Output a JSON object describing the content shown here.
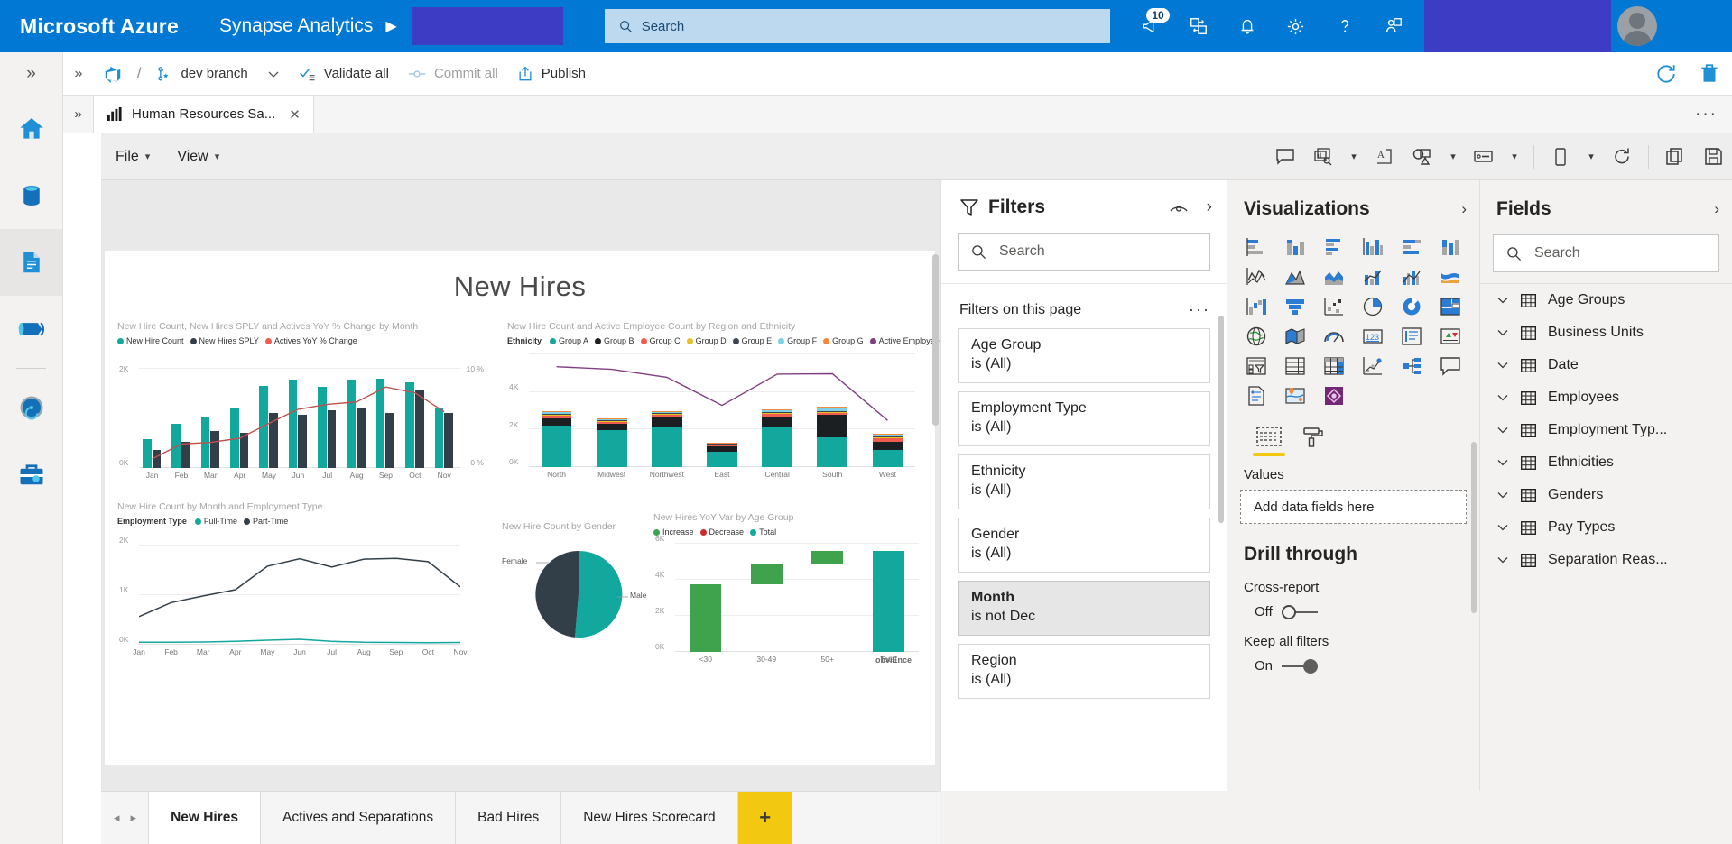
{
  "azure": {
    "brand": "Microsoft Azure",
    "service": "Synapse Analytics",
    "service_chevron": "▶",
    "search_placeholder": "Search",
    "notifications_badge": "10",
    "icons": [
      "megaphone-icon",
      "cloudshell-icon",
      "bell-icon",
      "gear-icon",
      "help-icon",
      "feedback-icon"
    ]
  },
  "synapse_toolbar": {
    "slash": "/",
    "branch": "dev branch",
    "branch_chevron": "⌄",
    "validate_all": "Validate all",
    "commit_all": "Commit all",
    "publish": "Publish"
  },
  "report_tab": {
    "label": "Human Resources Sa...",
    "close": "✕",
    "expand": "»",
    "overflow": "···"
  },
  "pbi_toolbar": {
    "file": "File",
    "view": "View",
    "chevron": "⌄",
    "icons": [
      "comment-icon",
      "bookmarks-icon",
      "chevron-down-icon",
      "text-box-icon",
      "shapes-icon",
      "chevron-down-icon",
      "buttons-icon",
      "chevron-down-icon",
      "mobile-layout-icon",
      "chevron-down-icon",
      "refresh-icon",
      "duplicate-page-icon",
      "save-icon"
    ]
  },
  "report": {
    "title": "New Hires"
  },
  "chart_data": [
    {
      "type": "bar",
      "id": "new-hire-count-by-month",
      "title": "New Hire Count, New Hires SPLY and Actives YoY % Change by Month",
      "legend": [
        {
          "label": "New Hire Count",
          "color": "#13a89e"
        },
        {
          "label": "New Hires SPLY",
          "color": "#333f48"
        },
        {
          "label": "Actives YoY % Change",
          "color": "#ee5d50"
        }
      ],
      "categories": [
        "Jan",
        "Feb",
        "Mar",
        "Apr",
        "May",
        "Jun",
        "Jul",
        "Aug",
        "Sep",
        "Oct",
        "Nov"
      ],
      "series": [
        {
          "name": "New Hire Count",
          "color": "#13a89e",
          "values": [
            700,
            1080,
            1250,
            1450,
            1990,
            2130,
            1970,
            2130,
            2170,
            2070,
            1440
          ]
        },
        {
          "name": "New Hires SPLY",
          "color": "#333f48",
          "values": [
            430,
            640,
            900,
            860,
            1330,
            1280,
            1390,
            1470,
            1330,
            1900,
            1340
          ]
        },
        {
          "name": "Actives YoY % Change",
          "color": "#c0504d",
          "values": [
            1.1,
            2.9,
            3.1,
            3.6,
            5.4,
            7.1,
            7.7,
            8.0,
            9.8,
            9.1,
            6.8
          ]
        }
      ],
      "ylabel": "",
      "ylim": [
        0,
        2400
      ],
      "yticks": [
        "0K",
        "2K"
      ],
      "y2ticks": [
        "0 %",
        "10 %"
      ],
      "y2lim": [
        0,
        12
      ],
      "grid": true,
      "legend_position": "top"
    },
    {
      "type": "bar",
      "id": "new-hire-by-region-ethnicity",
      "title": "New Hire Count and Active Employee Count by Region and Ethnicity",
      "legend_title": "Ethnicity",
      "legend": [
        {
          "label": "Group A",
          "color": "#13a89e"
        },
        {
          "label": "Group B",
          "color": "#1b1f22"
        },
        {
          "label": "Group C",
          "color": "#ee5d50"
        },
        {
          "label": "Group D",
          "color": "#e8c020"
        },
        {
          "label": "Group E",
          "color": "#3b4650"
        },
        {
          "label": "Group F",
          "color": "#7dd0e8"
        },
        {
          "label": "Group G",
          "color": "#f2893f"
        },
        {
          "label": "Active Employee Count",
          "color": "#80407f"
        }
      ],
      "categories": [
        "North",
        "Midwest",
        "Northwest",
        "East",
        "Central",
        "South",
        "West"
      ],
      "stacked": true,
      "series": [
        {
          "name": "Group A",
          "color": "#13a89e",
          "values": [
            2380,
            2100,
            2250,
            860,
            2300,
            1680,
            980
          ]
        },
        {
          "name": "Group B",
          "color": "#1b1f22",
          "values": [
            360,
            350,
            620,
            300,
            580,
            1270,
            460
          ]
        },
        {
          "name": "Group C",
          "color": "#ee5d50",
          "values": [
            160,
            130,
            90,
            90,
            150,
            100,
            190
          ]
        },
        {
          "name": "Group D",
          "color": "#e8c020",
          "values": [
            80,
            70,
            60,
            50,
            70,
            90,
            80
          ]
        },
        {
          "name": "Group E",
          "color": "#3b4650",
          "values": [
            40,
            30,
            30,
            30,
            40,
            40,
            30
          ]
        },
        {
          "name": "Group F",
          "color": "#7dd0e8",
          "values": [
            140,
            40,
            80,
            40,
            90,
            160,
            110
          ]
        },
        {
          "name": "Group G",
          "color": "#f2893f",
          "values": [
            40,
            20,
            30,
            20,
            30,
            80,
            40
          ]
        }
      ],
      "line_series": {
        "name": "Active Employee Count",
        "color": "#80407f",
        "values": [
          5700,
          5550,
          5100,
          3500,
          5280,
          5300,
          2650
        ]
      },
      "ylim": [
        0,
        6400
      ],
      "yticks": [
        "0K",
        "2K",
        "4K"
      ],
      "grid": true,
      "legend_position": "top"
    },
    {
      "type": "line",
      "id": "new-hire-by-month-employment-type",
      "title": "New Hire Count by Month and Employment Type",
      "legend_title": "Employment Type",
      "legend": [
        {
          "label": "Full-Time",
          "color": "#13a89e"
        },
        {
          "label": "Part-Time",
          "color": "#333f48"
        }
      ],
      "categories": [
        "Jan",
        "Feb",
        "Mar",
        "Apr",
        "May",
        "Jun",
        "Jul",
        "Aug",
        "Sep",
        "Oct",
        "Nov"
      ],
      "series": [
        {
          "name": "Part-Time",
          "color": "#333f48",
          "values": [
            680,
            1020,
            1180,
            1330,
            1900,
            2080,
            1880,
            2070,
            2090,
            2010,
            1400
          ]
        },
        {
          "name": "Full-Time",
          "color": "#13a89e",
          "values": [
            60,
            60,
            65,
            80,
            110,
            130,
            80,
            60,
            55,
            50,
            55
          ]
        }
      ],
      "ylim": [
        0,
        2400
      ],
      "yticks": [
        "0K",
        "1K",
        "2K"
      ],
      "grid": true,
      "legend_position": "top"
    },
    {
      "type": "pie",
      "id": "new-hire-count-by-gender",
      "title": "New Hire Count by Gender",
      "labels": [
        "Male",
        "Female"
      ],
      "values": [
        52,
        48
      ],
      "colors": [
        "#13a89e",
        "#333f48"
      ]
    },
    {
      "type": "bar",
      "id": "new-hires-yoy-var-by-age-group",
      "title": "New Hires YoY Var by Age Group",
      "legend": [
        {
          "label": "Increase",
          "color": "#3fa34d"
        },
        {
          "label": "Decrease",
          "color": "#d22a2a"
        },
        {
          "label": "Total",
          "color": "#13a89e"
        }
      ],
      "categories": [
        "<30",
        "30-49",
        "50+",
        "Total"
      ],
      "waterfall": [
        {
          "category": "<30",
          "start": 0,
          "end": 4000,
          "kind": "Increase"
        },
        {
          "category": "30-49",
          "start": 4000,
          "end": 5250,
          "kind": "Increase"
        },
        {
          "category": "50+",
          "start": 5250,
          "end": 5950,
          "kind": "Increase"
        },
        {
          "category": "Total",
          "start": 0,
          "end": 5950,
          "kind": "Total"
        }
      ],
      "ylim": [
        0,
        6400
      ],
      "yticks": [
        "0K",
        "2K",
        "4K",
        "6K"
      ],
      "grid": true,
      "legend_position": "top"
    }
  ],
  "watermark": "obviEnce",
  "filters": {
    "title": "Filters",
    "search_placeholder": "Search",
    "section_label": "Filters on this page",
    "overflow": "···",
    "expand_arrow": "›",
    "items": [
      {
        "name": "Age Group",
        "value": "is (All)",
        "active": false
      },
      {
        "name": "Employment Type",
        "value": "is (All)",
        "active": false
      },
      {
        "name": "Ethnicity",
        "value": "is (All)",
        "active": false
      },
      {
        "name": "Gender",
        "value": "is (All)",
        "active": false
      },
      {
        "name": "Month",
        "value": "is not Dec",
        "active": true
      },
      {
        "name": "Region",
        "value": "is (All)",
        "active": false
      }
    ]
  },
  "visualizations": {
    "title": "Visualizations",
    "expand_arrow": "›",
    "gallery": [
      "stacked-bar-chart-icon",
      "stacked-column-chart-icon",
      "clustered-bar-chart-icon",
      "clustered-column-chart-icon",
      "100-stacked-bar-chart-icon",
      "100-stacked-column-chart-icon",
      "line-chart-icon",
      "area-chart-icon",
      "stacked-area-chart-icon",
      "line-and-stacked-column-chart-icon",
      "line-and-clustered-column-chart-icon",
      "ribbon-chart-icon",
      "waterfall-chart-icon",
      "funnel-chart-icon",
      "scatter-chart-icon",
      "pie-chart-icon",
      "donut-chart-icon",
      "treemap-icon",
      "map-icon",
      "filled-map-icon",
      "gauge-icon",
      "card-icon",
      "multi-row-card-icon",
      "kpi-icon",
      "slicer-icon",
      "table-icon",
      "matrix-icon",
      "r-script-visual-icon",
      "decomposition-tree-icon",
      "q-and-a-icon",
      "paginated-report-icon",
      "arcgis-maps-icon",
      "power-apps-icon"
    ],
    "tabs": [
      "fields-well-icon",
      "format-paint-roller-icon"
    ],
    "values_label": "Values",
    "drop_placeholder": "Add data fields here",
    "drill_through_title": "Drill through",
    "cross_report_label": "Cross-report",
    "cross_report_state": "Off",
    "keep_all_filters_label": "Keep all filters",
    "keep_all_filters_state": "On"
  },
  "fields": {
    "title": "Fields",
    "expand_arrow": "›",
    "search_placeholder": "Search",
    "items": [
      {
        "label": "Age Groups"
      },
      {
        "label": "Business Units"
      },
      {
        "label": "Date"
      },
      {
        "label": "Employees"
      },
      {
        "label": "Employment Typ..."
      },
      {
        "label": "Ethnicities"
      },
      {
        "label": "Genders"
      },
      {
        "label": "Pay Types"
      },
      {
        "label": "Separation Reas..."
      }
    ]
  },
  "page_tabs": {
    "prev": "◂",
    "next": "▸",
    "add": "+",
    "items": [
      {
        "label": "New Hires",
        "active": true
      },
      {
        "label": "Actives and Separations",
        "active": false
      },
      {
        "label": "Bad Hires",
        "active": false
      },
      {
        "label": "New Hires Scorecard",
        "active": false
      }
    ]
  }
}
